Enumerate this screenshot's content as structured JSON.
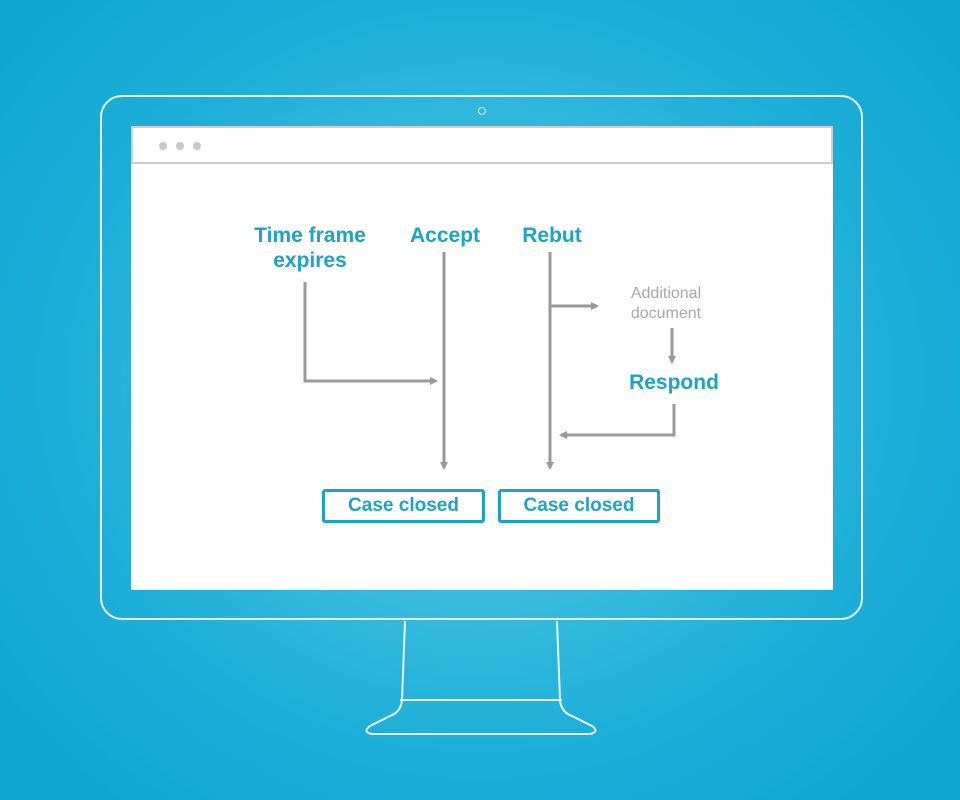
{
  "colors": {
    "accent": "#1ba3c8",
    "arrow": "#9a9a9a",
    "secondary_text": "#a9a9a9",
    "background": "#1eafd8"
  },
  "browser": {
    "window_controls": [
      "dot",
      "dot",
      "dot"
    ]
  },
  "diagram": {
    "nodes": {
      "time_frame": "Time frame expires",
      "time_frame_line1": "Time frame",
      "time_frame_line2": "expires",
      "accept": "Accept",
      "rebut": "Rebut",
      "additional_line1": "Additional",
      "additional_line2": "document",
      "respond": "Respond",
      "case_closed_1": "Case closed",
      "case_closed_2": "Case closed"
    },
    "edges": [
      {
        "from": "Time frame expires",
        "to": "Accept line"
      },
      {
        "from": "Accept",
        "to": "Case closed (left)"
      },
      {
        "from": "Rebut",
        "to": "Additional document"
      },
      {
        "from": "Additional document",
        "to": "Respond"
      },
      {
        "from": "Respond",
        "to": "Rebut line"
      },
      {
        "from": "Rebut",
        "to": "Case closed (right)"
      }
    ]
  }
}
